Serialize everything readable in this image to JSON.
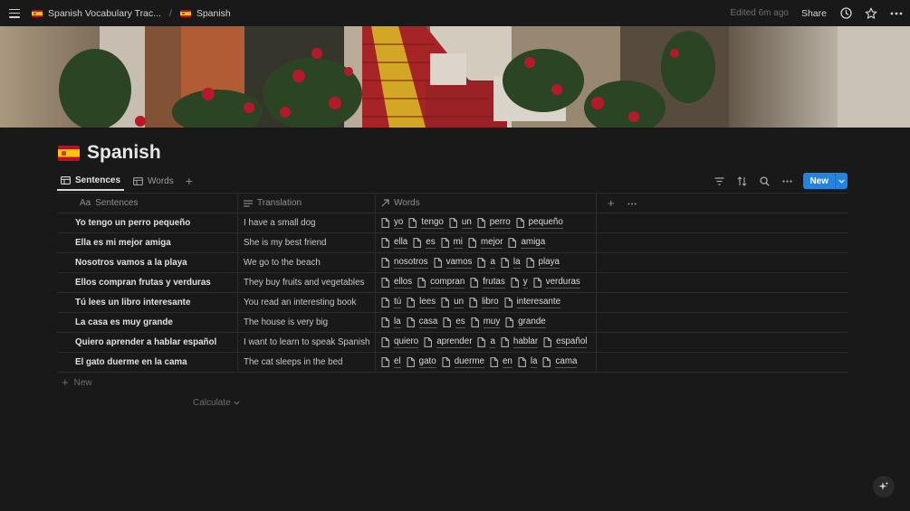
{
  "topbar": {
    "breadcrumb": [
      {
        "label": "Spanish Vocabulary Trac...",
        "icon": "spain-flag-icon"
      },
      {
        "label": "Spanish",
        "icon": "spain-flag-icon"
      }
    ],
    "separator": "/",
    "edited": "Edited 6m ago",
    "share_label": "Share"
  },
  "page": {
    "title": "Spanish",
    "icon": "spain-flag-icon"
  },
  "views": {
    "tabs": [
      {
        "label": "Sentences",
        "active": true,
        "icon": "table-icon"
      },
      {
        "label": "Words",
        "active": false,
        "icon": "table-icon"
      }
    ],
    "add_label": "+",
    "new_label": "New"
  },
  "table": {
    "columns": [
      {
        "label": "Sentences",
        "prefix": "Aa",
        "icon": "title-icon"
      },
      {
        "label": "Translation",
        "icon": "text-lines-icon"
      },
      {
        "label": "Words",
        "icon": "relation-arrow-icon"
      }
    ],
    "rows": [
      {
        "sentence": "Yo tengo un perro pequeño",
        "translation": "I have a small dog",
        "words": [
          "yo",
          "tengo",
          "un",
          "perro",
          "pequeño"
        ]
      },
      {
        "sentence": "Ella es mi mejor amiga",
        "translation": "She is my best friend",
        "words": [
          "ella",
          "es",
          "mi",
          "mejor",
          "amiga"
        ]
      },
      {
        "sentence": "Nosotros vamos a la playa",
        "translation": "We go to the beach",
        "words": [
          "nosotros",
          "vamos",
          "a",
          "la",
          "playa"
        ]
      },
      {
        "sentence": "Ellos compran frutas y verduras",
        "translation": "They buy fruits and vegetables",
        "words": [
          "ellos",
          "compran",
          "frutas",
          "y",
          "verduras"
        ]
      },
      {
        "sentence": "Tú lees un libro interesante",
        "translation": "You read an interesting book",
        "words": [
          "tú",
          "lees",
          "un",
          "libro",
          "interesante"
        ]
      },
      {
        "sentence": "La casa es muy grande",
        "translation": "The house is very big",
        "words": [
          "la",
          "casa",
          "es",
          "muy",
          "grande"
        ]
      },
      {
        "sentence": "Quiero aprender a hablar español",
        "translation": "I want to learn to speak Spanish",
        "words": [
          "quiero",
          "aprender",
          "a",
          "hablar",
          "español"
        ]
      },
      {
        "sentence": "El gato duerme en la cama",
        "translation": "The cat sleeps in the bed",
        "words": [
          "el",
          "gato",
          "duerme",
          "en",
          "la",
          "cama"
        ]
      }
    ],
    "new_row_label": "New",
    "calculate_label": "Calculate"
  },
  "colors": {
    "background": "#191919",
    "accent": "#2383e2",
    "border": "#2c2c2c"
  }
}
